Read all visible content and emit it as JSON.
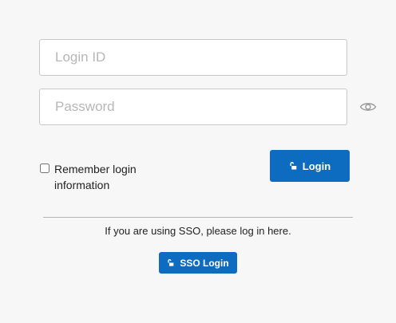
{
  "login_form": {
    "login_id_placeholder": "Login ID",
    "password_placeholder": "Password",
    "remember_label": "Remember login information",
    "login_button_label": "Login",
    "show_password_icon": "eye-icon",
    "lock_icon": "unlock-icon"
  },
  "sso": {
    "prompt_text": "If you are using SSO, please log in here.",
    "button_label": "SSO Login"
  },
  "colors": {
    "primary_button": "#0d6bc0",
    "background": "#f7f7f7",
    "field_border": "#c9c9c9"
  }
}
